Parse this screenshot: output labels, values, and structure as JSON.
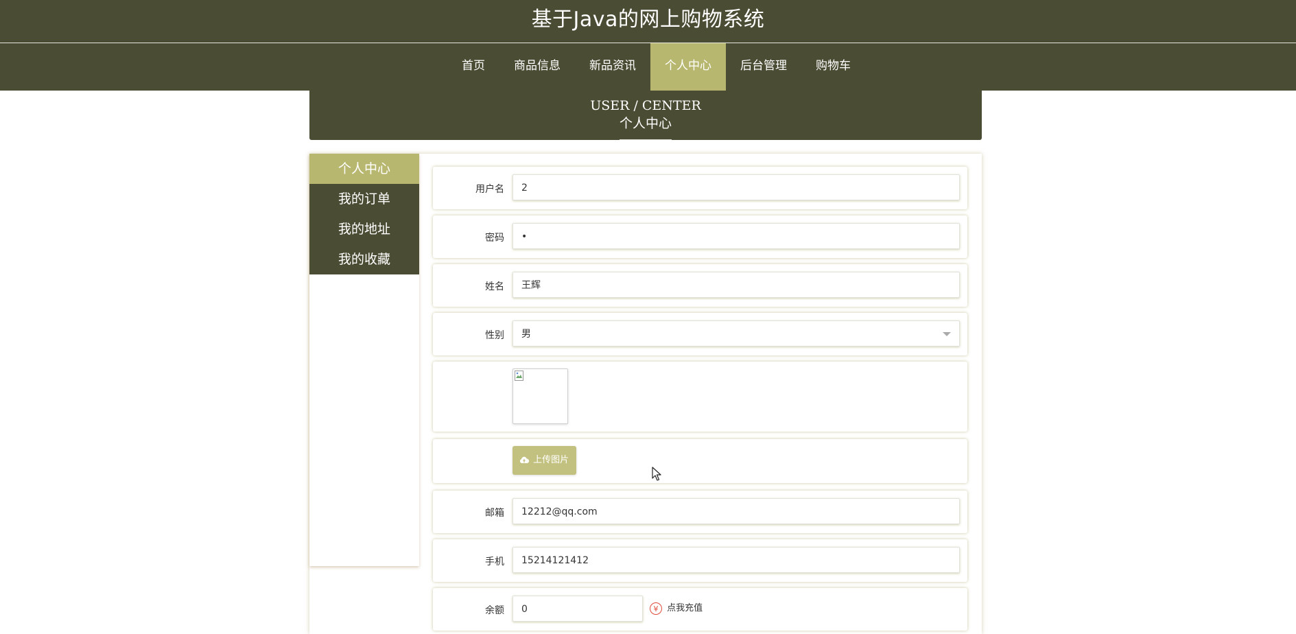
{
  "header": {
    "title": "基于Java的网上购物系统"
  },
  "nav": {
    "items": [
      {
        "label": "首页"
      },
      {
        "label": "商品信息"
      },
      {
        "label": "新品资讯"
      },
      {
        "label": "个人中心",
        "active": true
      },
      {
        "label": "后台管理"
      },
      {
        "label": "购物车"
      }
    ]
  },
  "banner": {
    "en": "USER / CENTER",
    "cn": "个人中心"
  },
  "sidebar": {
    "items": [
      {
        "label": "个人中心",
        "active": true
      },
      {
        "label": "我的订单"
      },
      {
        "label": "我的地址"
      },
      {
        "label": "我的收藏"
      }
    ]
  },
  "form": {
    "username": {
      "label": "用户名",
      "value": "2"
    },
    "password": {
      "label": "密码",
      "value": "•"
    },
    "name": {
      "label": "姓名",
      "value": "王辉"
    },
    "gender": {
      "label": "性别",
      "value": "男"
    },
    "upload_label": "上传图片",
    "email": {
      "label": "邮箱",
      "value": "12212@qq.com"
    },
    "phone": {
      "label": "手机",
      "value": "15214121412"
    },
    "balance": {
      "label": "余额",
      "value": "0"
    },
    "recharge_label": "点我充值"
  },
  "colors": {
    "dark": "#4b4c34",
    "accent": "#b8b770",
    "upload": "#c3c17f",
    "yen": "#e04a3a"
  },
  "icons": {
    "upload": "cloud-upload-icon",
    "recharge": "yen-icon",
    "cursor": "mouse-pointer-icon",
    "select": "chevron-down-icon"
  }
}
